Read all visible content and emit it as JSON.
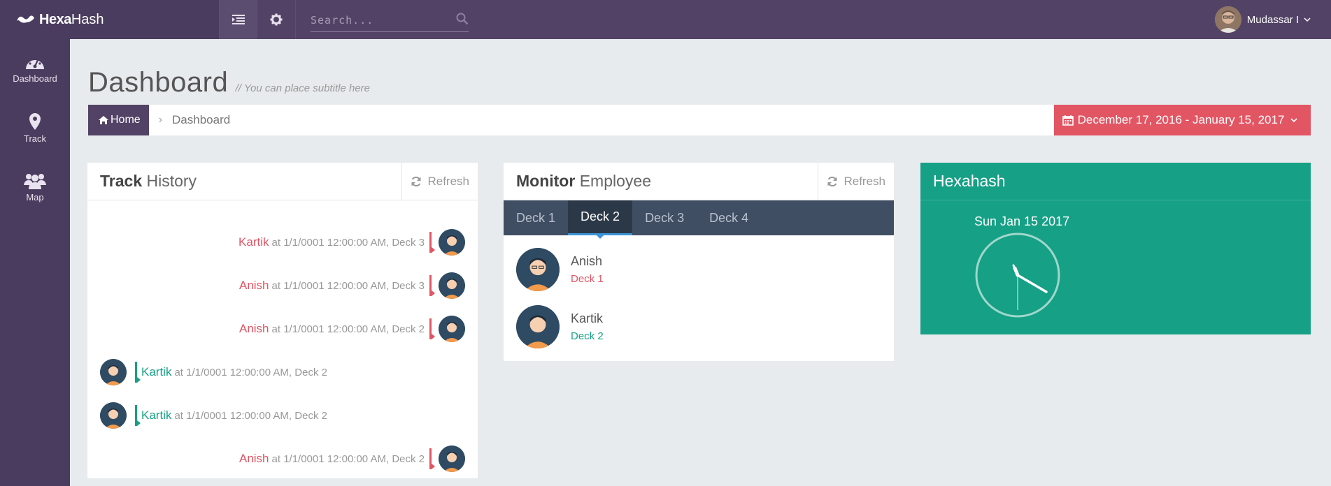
{
  "brand": {
    "bold": "Hexa",
    "light": "Hash"
  },
  "search": {
    "placeholder": "Search..."
  },
  "user": {
    "name": "Mudassar I"
  },
  "sidebar": {
    "items": [
      {
        "label": "Dashboard",
        "icon": "dashboard-gauge-icon"
      },
      {
        "label": "Track",
        "icon": "map-marker-icon"
      },
      {
        "label": "Map",
        "icon": "users-group-icon"
      }
    ]
  },
  "page": {
    "title": "Dashboard",
    "subtitle": "// You can place subtitle here"
  },
  "breadcrumb": {
    "home": "Home",
    "current": "Dashboard"
  },
  "date_range": {
    "label": "December 17, 2016 - January 15, 2017"
  },
  "track_history": {
    "title_bold": "Track",
    "title_light": "History",
    "refresh": "Refresh",
    "entries": [
      {
        "name": "Kartik",
        "text": "at 1/1/0001 12:00:00 AM, Deck 3",
        "side": "right"
      },
      {
        "name": "Anish",
        "text": "at 1/1/0001 12:00:00 AM, Deck 3",
        "side": "right"
      },
      {
        "name": "Anish",
        "text": "at 1/1/0001 12:00:00 AM, Deck 2",
        "side": "right"
      },
      {
        "name": "Kartik",
        "text": "at 1/1/0001 12:00:00 AM, Deck 2",
        "side": "left"
      },
      {
        "name": "Kartik",
        "text": "at 1/1/0001 12:00:00 AM, Deck 2",
        "side": "left"
      },
      {
        "name": "Anish",
        "text": "at 1/1/0001 12:00:00 AM, Deck 2",
        "side": "right"
      }
    ]
  },
  "monitor": {
    "title_bold": "Monitor",
    "title_light": "Employee",
    "refresh": "Refresh",
    "tabs": [
      "Deck 1",
      "Deck 2",
      "Deck 3",
      "Deck 4"
    ],
    "active_tab": "Deck 2",
    "employees": [
      {
        "name": "Anish",
        "deck": "Deck 1"
      },
      {
        "name": "Kartik",
        "deck": "Deck 2"
      }
    ]
  },
  "clock": {
    "title": "Hexahash",
    "date": "Sun Jan 15 2017"
  },
  "colors": {
    "topbar": "#524366",
    "sidebar": "#4a3c5e",
    "accent_red": "#e25563",
    "accent_green": "#16a085",
    "tabs_bg": "#3f4e62"
  }
}
